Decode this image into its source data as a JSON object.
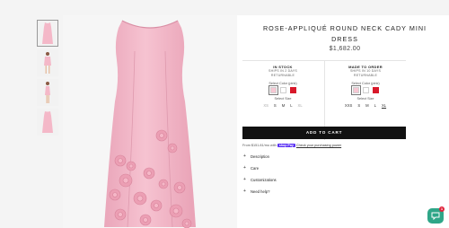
{
  "product": {
    "title": "ROSE-APPLIQUÉ ROUND NECK CADY MINI DRESS",
    "price": "$1,682.00"
  },
  "gallery": {
    "thumbnails": [
      "thumb-front",
      "thumb-model-front",
      "thumb-model-side",
      "thumb-back"
    ],
    "selected_index": 0
  },
  "options": {
    "in_stock": {
      "status": "IN STOCK",
      "note_1": "SHIPS IN 2 DAYS",
      "note_2": "RETURNABLE",
      "color_label": "Select Color (pink)",
      "size_label": "Select Size",
      "sizes": [
        "XS",
        "S",
        "M",
        "L",
        "XL"
      ]
    },
    "made_to_order": {
      "status": "MADE TO ORDER",
      "note_1": "SHIPS IN 10 DAYS",
      "note_2": "RETURNABLE",
      "color_label": "Select Color (pink)",
      "size_label": "Select Size",
      "sizes": [
        "XXS",
        "S",
        "M",
        "L",
        "XL"
      ]
    },
    "swatch_colors": [
      "#f6c7d3",
      "#ffffff",
      "#d8182a"
    ]
  },
  "cart": {
    "add_label": "ADD TO CART"
  },
  "shoppay": {
    "prefix": "From $151.81/mo with",
    "brand": "shop Pay",
    "link": "Check your purchasing power"
  },
  "accordion": [
    "Description",
    "Care",
    "Customizations",
    "Need help?"
  ],
  "chat": {
    "badge": "1"
  },
  "colors": {
    "accent_button": "#111111",
    "chat": "#2fa688",
    "dress_pink": "#f4b8c8"
  }
}
